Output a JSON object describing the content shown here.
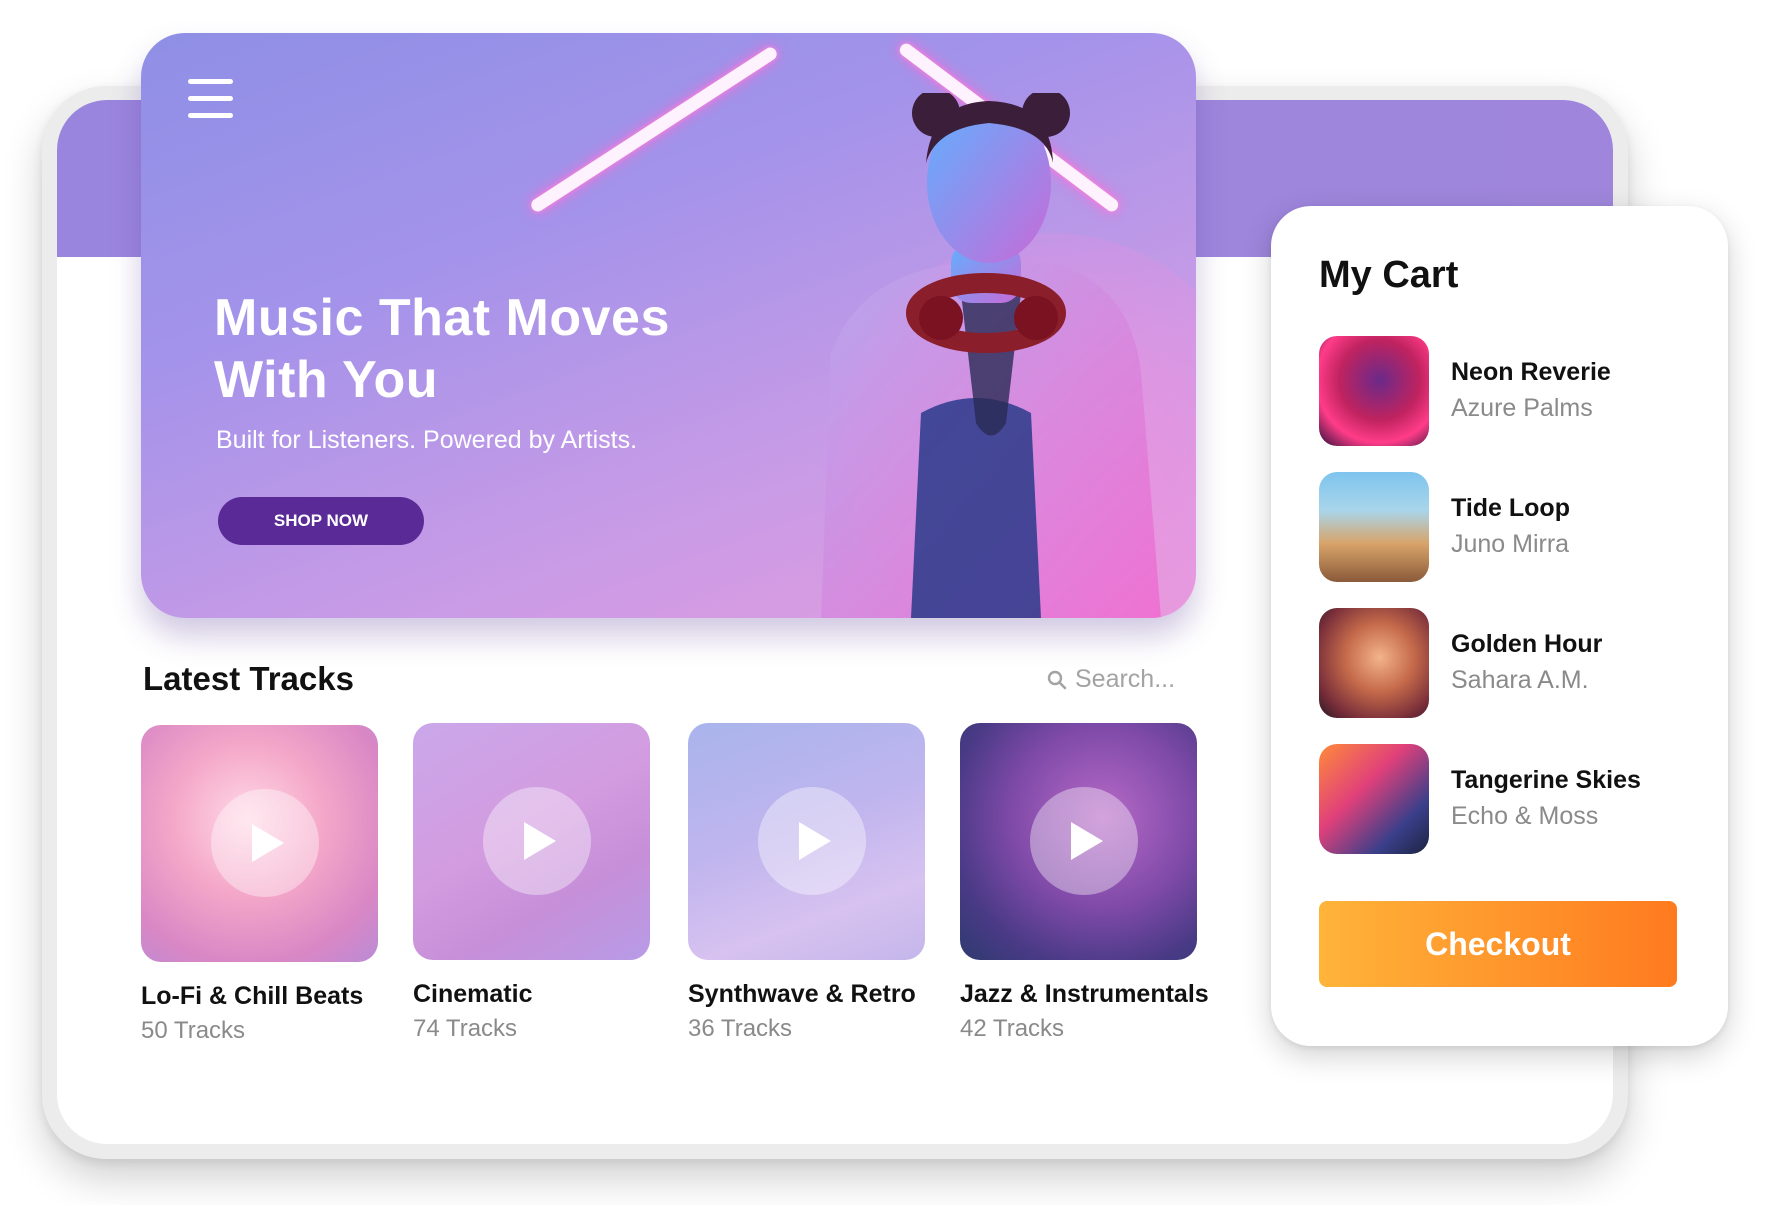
{
  "hero": {
    "title": "Music That Moves With You",
    "subtitle": "Built for Listeners. Powered by Artists.",
    "cta_label": "SHOP NOW"
  },
  "latest": {
    "title": "Latest Tracks",
    "search_placeholder": "Search...",
    "tracks": [
      {
        "name": "Lo-Fi & Chill Beats",
        "count": "50 Tracks"
      },
      {
        "name": "Cinematic",
        "count": "74 Tracks"
      },
      {
        "name": "Synthwave & Retro",
        "count": "36 Tracks"
      },
      {
        "name": "Jazz & Instrumentals",
        "count": "42 Tracks"
      }
    ]
  },
  "cart": {
    "title": "My Cart",
    "items": [
      {
        "title": "Neon Reverie",
        "artist": "Azure Palms"
      },
      {
        "title": "Tide Loop",
        "artist": "Juno Mirra"
      },
      {
        "title": "Golden Hour",
        "artist": "Sahara A.M."
      },
      {
        "title": "Tangerine Skies",
        "artist": "Echo & Moss"
      }
    ],
    "checkout_label": "Checkout"
  },
  "colors": {
    "band": "#9a85de",
    "cta": "#5a2a96",
    "checkout_start": "#ffb43a",
    "checkout_end": "#ff7a1f"
  },
  "icons": {
    "menu": "hamburger-menu-icon",
    "search": "search-icon",
    "play": "play-icon"
  }
}
